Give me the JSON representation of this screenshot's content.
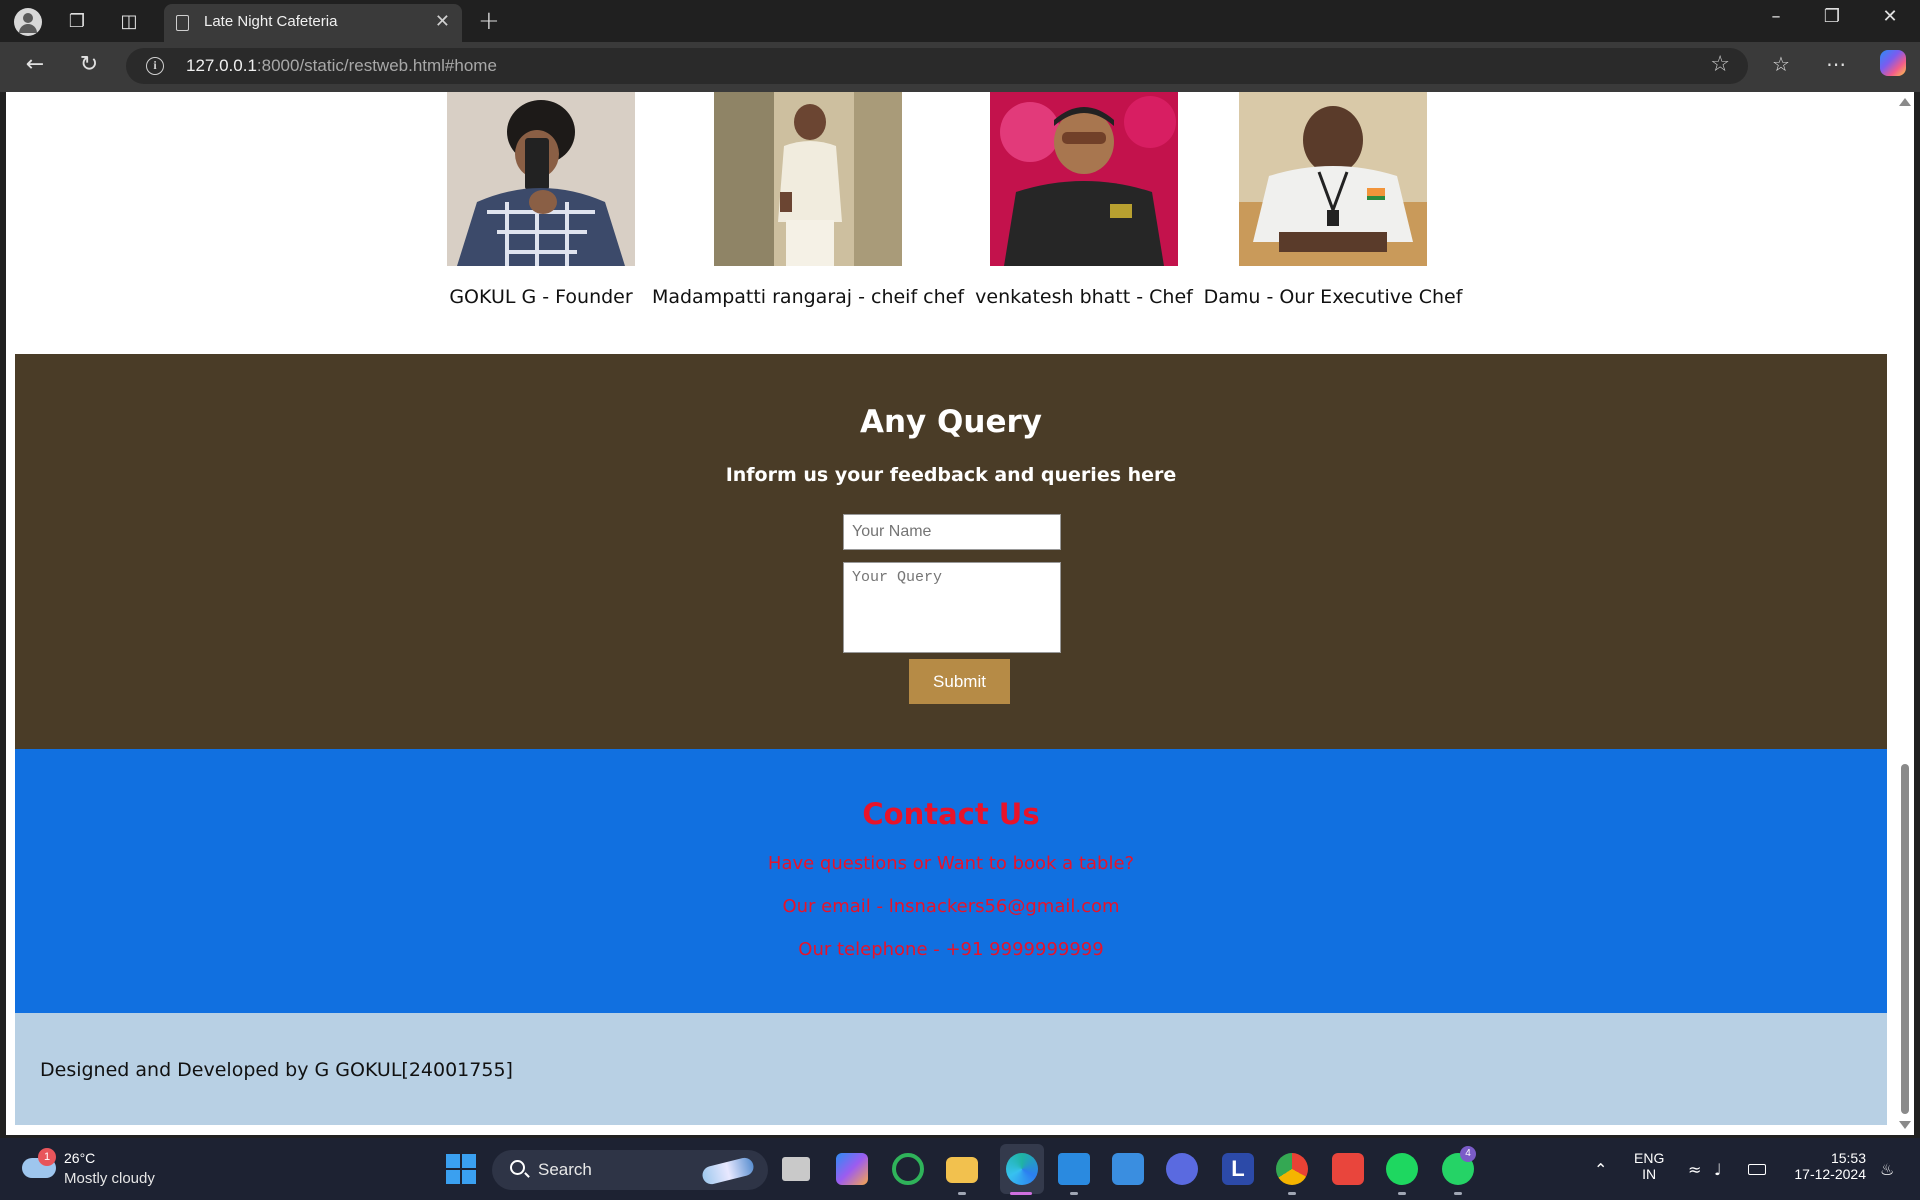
{
  "browser": {
    "tab_title": "Late Night Cafeteria",
    "url_host": "127.0.0.1",
    "url_rest": ":8000/static/restweb.html#home"
  },
  "team": [
    {
      "name": "GOKUL G - Founder"
    },
    {
      "name": "Madampatti rangaraj - cheif chef"
    },
    {
      "name": "venkatesh bhatt - Chef"
    },
    {
      "name": "Damu - Our Executive Chef"
    }
  ],
  "query": {
    "heading": "Any Query",
    "subheading": "Inform us your feedback and queries here",
    "name_placeholder": "Your Name",
    "query_placeholder": "Your Query",
    "submit_label": "Submit"
  },
  "contact": {
    "heading": "Contact Us",
    "line1": "Have questions or Want to book a table?",
    "line2": "Our email - lnsnackers56@gmail.com",
    "line3": "Our telephone - +91 9999999999"
  },
  "footer": {
    "text": "Designed and Developed by G GOKUL[24001755]"
  },
  "taskbar": {
    "weather_badge": "1",
    "weather_temp": "26°C",
    "weather_desc": "Mostly cloudy",
    "search_label": "Search",
    "whatsapp_badge": "4",
    "lang_top": "ENG",
    "lang_bottom": "IN",
    "time": "15:53",
    "date": "17-12-2024"
  },
  "colors": {
    "query_bg": "#4a3c27",
    "submit_bg": "#b68b46",
    "contact_bg": "#1170e0",
    "contact_text": "#e8132a",
    "footer_bg": "#b8d0e4"
  }
}
